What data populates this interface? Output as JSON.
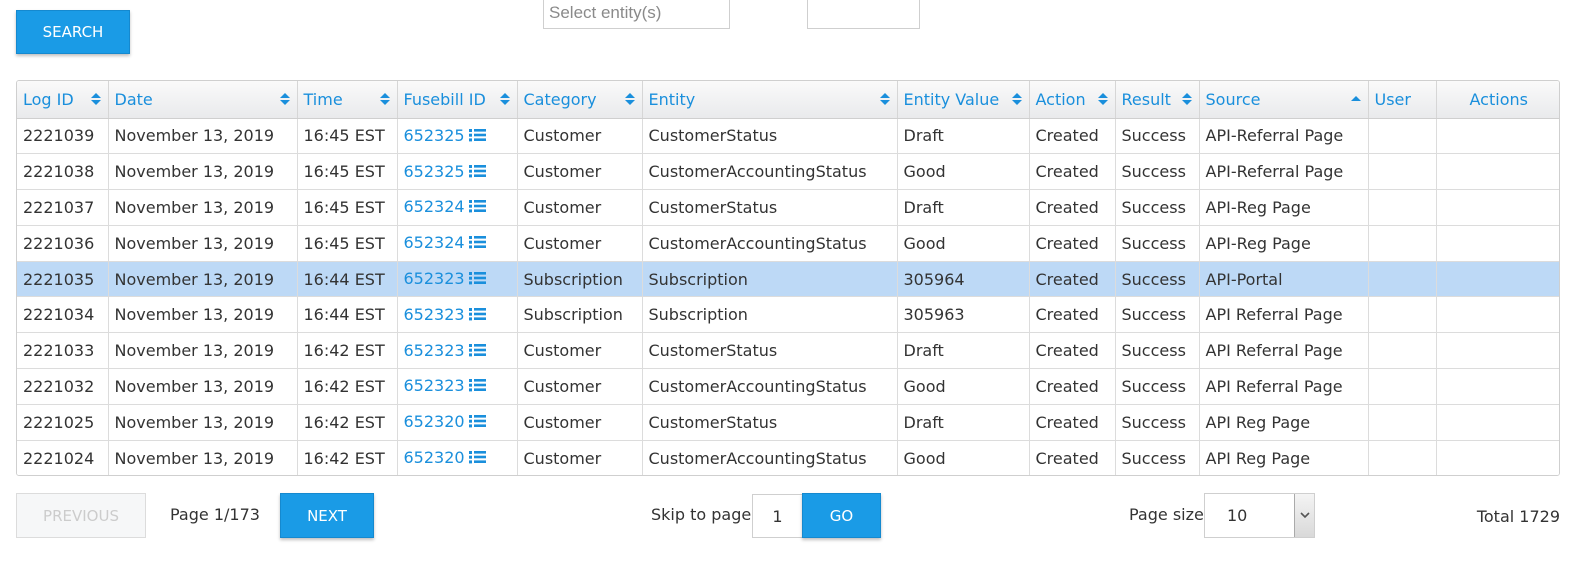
{
  "search_button": "SEARCH",
  "filters": {
    "entity_placeholder": "Select entity(s)",
    "second_value": ""
  },
  "columns": [
    {
      "label": "Log ID",
      "sort": "both"
    },
    {
      "label": "Date",
      "sort": "both"
    },
    {
      "label": "Time",
      "sort": "both"
    },
    {
      "label": "Fusebill ID",
      "sort": "both"
    },
    {
      "label": "Category",
      "sort": "both"
    },
    {
      "label": "Entity",
      "sort": "both"
    },
    {
      "label": "Entity Value",
      "sort": "both"
    },
    {
      "label": "Action",
      "sort": "both"
    },
    {
      "label": "Result",
      "sort": "both"
    },
    {
      "label": "Source",
      "sort": "asc"
    },
    {
      "label": "User",
      "sort": "none"
    },
    {
      "label": "Actions",
      "sort": "none"
    }
  ],
  "rows": [
    {
      "log_id": "2221039",
      "date": "November 13, 2019",
      "time": "16:45 EST",
      "fusebill_id": "652325",
      "category": "Customer",
      "entity": "CustomerStatus",
      "entity_value": "Draft",
      "action": "Created",
      "result": "Success",
      "source": "API-Referral Page",
      "user": "",
      "actions": "",
      "selected": false
    },
    {
      "log_id": "2221038",
      "date": "November 13, 2019",
      "time": "16:45 EST",
      "fusebill_id": "652325",
      "category": "Customer",
      "entity": "CustomerAccountingStatus",
      "entity_value": "Good",
      "action": "Created",
      "result": "Success",
      "source": "API-Referral Page",
      "user": "",
      "actions": "",
      "selected": false
    },
    {
      "log_id": "2221037",
      "date": "November 13, 2019",
      "time": "16:45 EST",
      "fusebill_id": "652324",
      "category": "Customer",
      "entity": "CustomerStatus",
      "entity_value": "Draft",
      "action": "Created",
      "result": "Success",
      "source": "API-Reg Page",
      "user": "",
      "actions": "",
      "selected": false
    },
    {
      "log_id": "2221036",
      "date": "November 13, 2019",
      "time": "16:45 EST",
      "fusebill_id": "652324",
      "category": "Customer",
      "entity": "CustomerAccountingStatus",
      "entity_value": "Good",
      "action": "Created",
      "result": "Success",
      "source": "API-Reg Page",
      "user": "",
      "actions": "",
      "selected": false
    },
    {
      "log_id": "2221035",
      "date": "November 13, 2019",
      "time": "16:44 EST",
      "fusebill_id": "652323",
      "category": "Subscription",
      "entity": "Subscription",
      "entity_value": "305964",
      "action": "Created",
      "result": "Success",
      "source": "API-Portal",
      "user": "",
      "actions": "",
      "selected": true
    },
    {
      "log_id": "2221034",
      "date": "November 13, 2019",
      "time": "16:44 EST",
      "fusebill_id": "652323",
      "category": "Subscription",
      "entity": "Subscription",
      "entity_value": "305963",
      "action": "Created",
      "result": "Success",
      "source": "API Referral Page",
      "user": "",
      "actions": "",
      "selected": false
    },
    {
      "log_id": "2221033",
      "date": "November 13, 2019",
      "time": "16:42 EST",
      "fusebill_id": "652323",
      "category": "Customer",
      "entity": "CustomerStatus",
      "entity_value": "Draft",
      "action": "Created",
      "result": "Success",
      "source": "API Referral Page",
      "user": "",
      "actions": "",
      "selected": false
    },
    {
      "log_id": "2221032",
      "date": "November 13, 2019",
      "time": "16:42 EST",
      "fusebill_id": "652323",
      "category": "Customer",
      "entity": "CustomerAccountingStatus",
      "entity_value": "Good",
      "action": "Created",
      "result": "Success",
      "source": "API Referral Page",
      "user": "",
      "actions": "",
      "selected": false
    },
    {
      "log_id": "2221025",
      "date": "November 13, 2019",
      "time": "16:42 EST",
      "fusebill_id": "652320",
      "category": "Customer",
      "entity": "CustomerStatus",
      "entity_value": "Draft",
      "action": "Created",
      "result": "Success",
      "source": "API Reg Page",
      "user": "",
      "actions": "",
      "selected": false
    },
    {
      "log_id": "2221024",
      "date": "November 13, 2019",
      "time": "16:42 EST",
      "fusebill_id": "652320",
      "category": "Customer",
      "entity": "CustomerAccountingStatus",
      "entity_value": "Good",
      "action": "Created",
      "result": "Success",
      "source": "API Reg Page",
      "user": "",
      "actions": "",
      "selected": false
    }
  ],
  "pagination": {
    "previous_label": "PREVIOUS",
    "page_info": "Page 1/173",
    "next_label": "NEXT",
    "skip_label": "Skip to page",
    "skip_value": "1",
    "go_label": "GO",
    "page_size_label": "Page size",
    "page_size_value": "10",
    "total_text": "Total 1729"
  },
  "colors": {
    "accent": "#1a9be6",
    "link": "#1a8fdc",
    "selected_row": "#bdd9f6"
  },
  "icons": {
    "fusebill_detail": "list-icon",
    "sort": "sort-icon",
    "select_caret": "chevron-down-icon"
  }
}
